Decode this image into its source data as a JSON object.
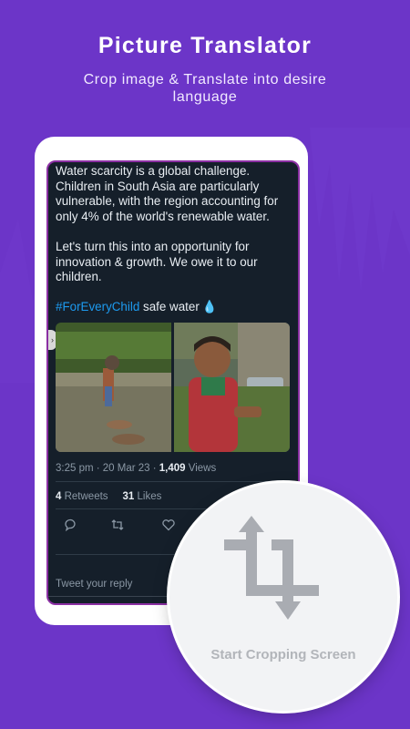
{
  "hero": {
    "title": "Picture Translator",
    "subtitle": "Crop image & Translate into desire language"
  },
  "tweet": {
    "paragraph1": "Water scarcity is a global challenge. Children in South Asia are particularly vulnerable, with the region accounting for only 4% of the world's renewable water.",
    "paragraph2": "Let's turn this into an opportunity for innovation & growth. We owe it to our children.",
    "hashtag": "#ForEveryChild",
    "hashtag_suffix": " safe water",
    "timestamp": "3:25 pm · 20 Mar 23 · ",
    "views_count": "1,409",
    "views_label": " Views",
    "retweets_count": "4",
    "retweets_label": " Retweets",
    "likes_count": "31",
    "likes_label": " Likes",
    "reply_placeholder": "Tweet your reply",
    "nav_glyph": "|||"
  },
  "crop": {
    "label": "Start Cropping Screen"
  },
  "icons": {
    "reply": "comment-icon",
    "retweet": "retweet-icon",
    "like": "heart-icon",
    "crop": "crop-icon",
    "drop": "water-drop-icon"
  },
  "colors": {
    "background": "#6c35c8",
    "tweet_bg": "#151f2a",
    "hashtag": "#1d9bf0",
    "crop_icon": "#a9acb2"
  }
}
